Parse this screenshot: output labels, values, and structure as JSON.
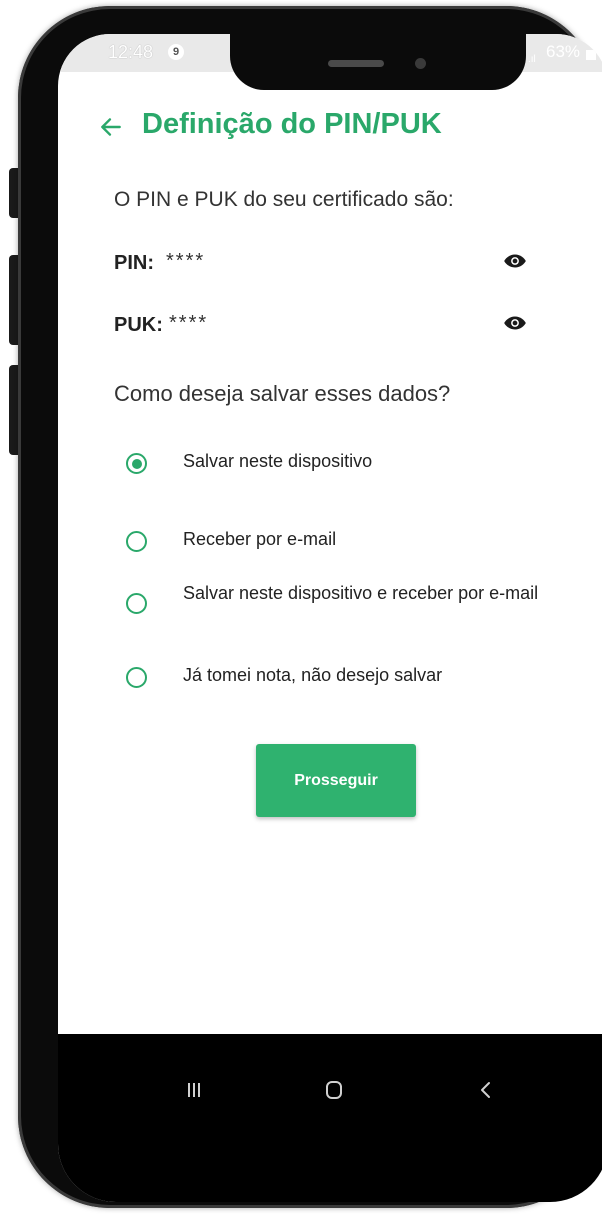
{
  "status_bar": {
    "time": "12:48",
    "notification_count": "9",
    "battery": "63%"
  },
  "header": {
    "title": "Definição do PIN/PUK",
    "back_icon": "arrow-left-icon"
  },
  "intro": "O PIN e PUK do seu certificado são:",
  "credentials": [
    {
      "label": "PIN:",
      "value": "****",
      "icon": "eye-icon"
    },
    {
      "label": "PUK:",
      "value": "****",
      "icon": "eye-icon"
    }
  ],
  "question": "Como deseja salvar esses dados?",
  "options": [
    {
      "label": "Salvar neste dispositivo",
      "checked": true
    },
    {
      "label": "Receber por e-mail",
      "checked": false
    },
    {
      "label": "Salvar neste dispositivo e receber por e-mail",
      "checked": false
    },
    {
      "label": "Já tomei nota, não desejo salvar",
      "checked": false
    }
  ],
  "primary_button": "Prosseguir",
  "nav": {
    "recents_icon": "recents-icon",
    "home_icon": "home-icon",
    "back_icon": "back-icon"
  },
  "colors": {
    "accent": "#2aa86a",
    "button": "#2fb26f"
  }
}
